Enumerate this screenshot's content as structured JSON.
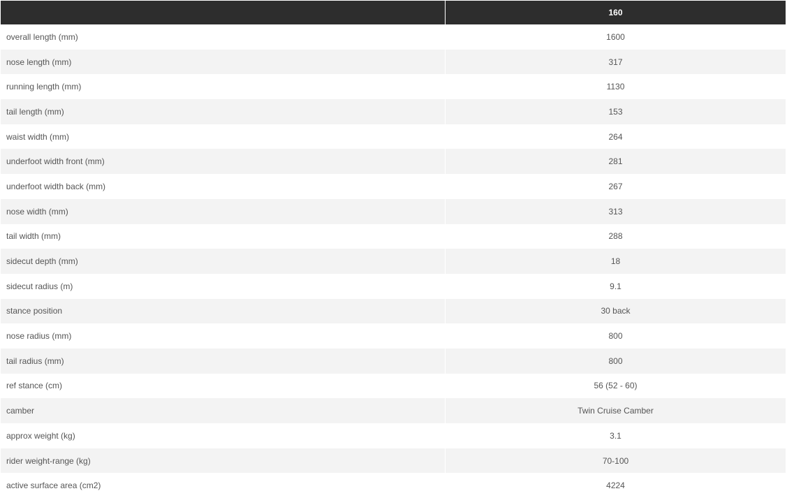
{
  "header": {
    "label": "",
    "size": "160"
  },
  "rows": [
    {
      "label": "overall length (mm)",
      "value": "1600"
    },
    {
      "label": "nose length (mm)",
      "value": "317"
    },
    {
      "label": "running length (mm)",
      "value": "1130"
    },
    {
      "label": "tail length (mm)",
      "value": "153"
    },
    {
      "label": "waist width (mm)",
      "value": "264"
    },
    {
      "label": "underfoot width front (mm)",
      "value": "281"
    },
    {
      "label": "underfoot width back (mm)",
      "value": "267"
    },
    {
      "label": "nose width (mm)",
      "value": "313"
    },
    {
      "label": "tail width (mm)",
      "value": "288"
    },
    {
      "label": "sidecut depth (mm)",
      "value": "18"
    },
    {
      "label": "sidecut radius (m)",
      "value": "9.1"
    },
    {
      "label": "stance position",
      "value": "30 back"
    },
    {
      "label": "nose radius (mm)",
      "value": "800"
    },
    {
      "label": "tail radius (mm)",
      "value": "800"
    },
    {
      "label": "ref stance (cm)",
      "value": "56 (52 - 60)"
    },
    {
      "label": "camber",
      "value": "Twin Cruise Camber"
    },
    {
      "label": "approx weight (kg)",
      "value": "3.1"
    },
    {
      "label": "rider weight-range (kg)",
      "value": "70-100"
    },
    {
      "label": "active surface area (cm2)",
      "value": "4224"
    }
  ],
  "colors": {
    "header_bg": "#2d2d2d",
    "header_text": "#ffffff",
    "row_alt_bg": "#f3f3f3",
    "text": "#555555"
  }
}
